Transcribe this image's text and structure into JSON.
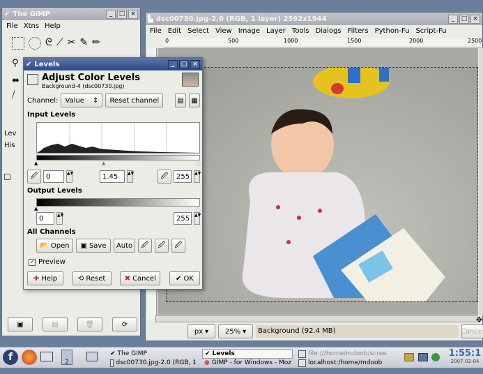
{
  "toolbox": {
    "title": "The GIMP",
    "menus": [
      "File",
      "Xtns",
      "Help"
    ],
    "side_labels": [
      "Lev",
      "His"
    ]
  },
  "image_window": {
    "title": "dsc00730.jpg-2.0 (RGB, 1 layer) 2592x1944",
    "menus": [
      "File",
      "Edit",
      "Select",
      "View",
      "Image",
      "Layer",
      "Tools",
      "Dialogs",
      "Filters",
      "Python-Fu",
      "Script-Fu"
    ],
    "ruler_ticks": [
      "0",
      "500",
      "1000",
      "1500",
      "2000",
      "2500"
    ],
    "unit": "px",
    "zoom": "25%",
    "status": "Background (92.4 MB)",
    "cancel_label": "Cancel"
  },
  "levels": {
    "title": "Levels",
    "heading": "Adjust Color Levels",
    "subheading": "Background-4 (dsc00730.jpg)",
    "channel_label": "Channel:",
    "channel_value": "Value",
    "reset_channel": "Reset channel",
    "input_levels": "Input Levels",
    "input_low": "0",
    "input_gamma": "1.45",
    "input_high": "255",
    "output_levels": "Output Levels",
    "output_low": "0",
    "output_high": "255",
    "all_channels": "All Channels",
    "open": "Open",
    "save": "Save",
    "auto": "Auto",
    "preview": "Preview",
    "help": "Help",
    "reset": "Reset",
    "cancel": "Cancel",
    "ok": "OK"
  },
  "taskbar": {
    "workspace": "2",
    "tasks": [
      "The GIMP",
      "dsc00730.jpg-2.0 (RGB, 1",
      "Levels",
      "GIMP - for Windows - Moz",
      "file:///home/mdoob/scree",
      "localhost:/home/mdoob"
    ],
    "time": "1:55:1",
    "date": "2007-02-04"
  }
}
